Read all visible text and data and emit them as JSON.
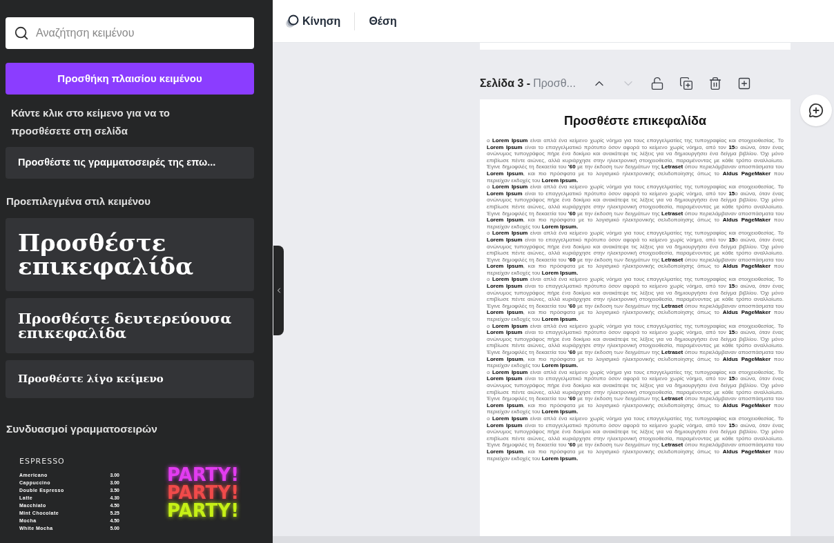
{
  "sidebar": {
    "search": {
      "placeholder": "Αναζήτηση κειμένου"
    },
    "add_button": "Προσθήκη πλαισίου κειμένου",
    "hint": "Κάντε κλικ στο κείμενο για να το προσθέσετε στη σελίδα",
    "brand_fonts_button": "Προσθέστε τις γραμματοσειρές της επω...",
    "styles_heading": "Προεπιλεγμένα στιλ κειμένου",
    "styles": [
      {
        "kind": "heading",
        "label": "Προσθέστε επικεφαλίδα"
      },
      {
        "kind": "subheading",
        "label": "Προσθέστε δευτερεύουσα επικεφαλίδα"
      },
      {
        "kind": "body",
        "label": "Προσθέστε λίγο κείμενο"
      }
    ],
    "combos_heading": "Συνδυασμοί γραμματοσειρών",
    "combos": [
      {
        "kind": "menu",
        "title": "ESPRESSO",
        "items": [
          {
            "name": "Americano",
            "price": "3.00"
          },
          {
            "name": "Cappuccino",
            "price": "3.00"
          },
          {
            "name": "Double Espresso",
            "price": "3.50"
          },
          {
            "name": "Latte",
            "price": "4.30"
          },
          {
            "name": "Macchiato",
            "price": "4.50"
          },
          {
            "name": "Mint Chocolate",
            "price": "5.25"
          },
          {
            "name": "Mocha",
            "price": "4.50"
          },
          {
            "name": "White Mocha",
            "price": "5.00"
          }
        ]
      },
      {
        "kind": "neon",
        "lines": [
          {
            "text": "PARTY!",
            "color": "#e23cf0"
          },
          {
            "text": "PARTY!",
            "color": "#f04a4a"
          },
          {
            "text": "PARTY!",
            "color": "#c6f016"
          }
        ]
      }
    ]
  },
  "toolbar": {
    "items": [
      {
        "kind": "animate",
        "label": "Κίνηση"
      },
      {
        "kind": "position",
        "label": "Θέση"
      }
    ]
  },
  "page_header": {
    "title": "Σελίδα 3 -",
    "name": "Προσθ...",
    "actions": [
      {
        "kind": "up",
        "disabled": false
      },
      {
        "kind": "down",
        "disabled": true
      },
      {
        "kind": "lock",
        "disabled": false
      },
      {
        "kind": "duplicate",
        "disabled": false
      },
      {
        "kind": "delete",
        "disabled": false
      },
      {
        "kind": "add",
        "disabled": false
      }
    ]
  },
  "page": {
    "heading": "Προσθέστε επικεφαλίδα",
    "paragraphs": [
      "ο **Lorem Ipsum** είναι απλά ένα κείμενο χωρίς νόημα για τους επαγγελματίες της τυπογραφίας και στοιχειοθεσίας. Το **Lorem Ipsum** είναι το επαγγελματικό πρότυπο όσον αφορά το κείμενο χωρίς νόημα, από τον **15**ο αιώνα, όταν ένας ανώνυμος τυπογράφος πήρε ένα δοκίμιο και ανακάτεψε τις λέξεις για να δημιουργήσει ένα δείγμα βιβλίου. Όχι μόνο επιβίωσε πέντε αιώνες, αλλά κυριάρχησε στην ηλεκτρονική στοιχειοθεσία, παραμένοντας με κάθε τρόπο αναλλοίωτο. Έγινε δημοφιλές τη δεκαετία του **'60** με την έκδοση των δειγμάτων της **Letraset** όπου περιελάμβαναν αποσπάσματα του **Lorem Ipsum**, και πιο πρόσφατα με το λογισμικό ηλεκτρονικής σελιδοποίησης όπως το **Aldus PageMaker** που περιείχαν εκδοχές του **Lorem Ipsum.**",
      "ο **Lorem Ipsum** είναι απλά ένα κείμενο χωρίς νόημα για τους επαγγελματίες της τυπογραφίας και στοιχειοθεσίας. Το **Lorem Ipsum** είναι το επαγγελματικό πρότυπο όσον αφορά το κείμενο χωρίς νόημα, από τον **15**ο αιώνα, όταν ένας ανώνυμος τυπογράφος πήρε ένα δοκίμιο και ανακάτεψε τις λέξεις για να δημιουργήσει ένα δείγμα βιβλίου. Όχι μόνο επιβίωσε πέντε αιώνες, αλλά κυριάρχησε στην ηλεκτρονική στοιχειοθεσία, παραμένοντας με κάθε τρόπο αναλλοίωτο. Έγινε δημοφιλές τη δεκαετία του **'60** με την έκδοση των δειγμάτων της **Letraset** όπου περιελάμβαναν αποσπάσματα του **Lorem Ipsum**, και πιο πρόσφατα με το λογισμικό ηλεκτρονικής σελιδοποίησης όπως το **Aldus PageMaker** που περιείχαν εκδοχές του **Lorem Ipsum.**",
      "ο **Lorem Ipsum** είναι απλά ένα κείμενο χωρίς νόημα για τους επαγγελματίες της τυπογραφίας και στοιχειοθεσίας. Το **Lorem Ipsum** είναι το επαγγελματικό πρότυπο όσον αφορά το κείμενο χωρίς νόημα, από τον **15**ο αιώνα, όταν ένας ανώνυμος τυπογράφος πήρε ένα δοκίμιο και ανακάτεψε τις λέξεις για να δημιουργήσει ένα δείγμα βιβλίου. Όχι μόνο επιβίωσε πέντε αιώνες, αλλά κυριάρχησε στην ηλεκτρονική στοιχειοθεσία, παραμένοντας με κάθε τρόπο αναλλοίωτο. Έγινε δημοφιλές τη δεκαετία του **'60** με την έκδοση των δειγμάτων της **Letraset** όπου περιελάμβαναν αποσπάσματα του **Lorem Ipsum**, και πιο πρόσφατα με το λογισμικό ηλεκτρονικής σελιδοποίησης όπως το **Aldus PageMaker** που περιείχαν εκδοχές του **Lorem Ipsum.**",
      "ο **Lorem Ipsum** είναι απλά ένα κείμενο χωρίς νόημα για τους επαγγελματίες της τυπογραφίας και στοιχειοθεσίας. Το **Lorem Ipsum** είναι το επαγγελματικό πρότυπο όσον αφορά το κείμενο χωρίς νόημα, από τον **15**ο αιώνα, όταν ένας ανώνυμος τυπογράφος πήρε ένα δοκίμιο και ανακάτεψε τις λέξεις για να δημιουργήσει ένα δείγμα βιβλίου. Όχι μόνο επιβίωσε πέντε αιώνες, αλλά κυριάρχησε στην ηλεκτρονική στοιχειοθεσία, παραμένοντας με κάθε τρόπο αναλλοίωτο. Έγινε δημοφιλές τη δεκαετία του **'60** με την έκδοση των δειγμάτων της **Letraset** όπου περιελάμβαναν αποσπάσματα του **Lorem Ipsum**, και πιο πρόσφατα με το λογισμικό ηλεκτρονικής σελιδοποίησης όπως το **Aldus PageMaker** που περιείχαν εκδοχές του **Lorem Ipsum.**",
      "ο **Lorem Ipsum** είναι απλά ένα κείμενο χωρίς νόημα για τους επαγγελματίες της τυπογραφίας και στοιχειοθεσίας. Το **Lorem Ipsum** είναι το επαγγελματικό πρότυπο όσον αφορά το κείμενο χωρίς νόημα, από τον **15**ο αιώνα, όταν ένας ανώνυμος τυπογράφος πήρε ένα δοκίμιο και ανακάτεψε τις λέξεις για να δημιουργήσει ένα δείγμα βιβλίου. Όχι μόνο επιβίωσε πέντε αιώνες, αλλά κυριάρχησε στην ηλεκτρονική στοιχειοθεσία, παραμένοντας με κάθε τρόπο αναλλοίωτο. Έγινε δημοφιλές τη δεκαετία του **'60** με την έκδοση των δειγμάτων της **Letraset** όπου περιελάμβαναν αποσπάσματα του **Lorem Ipsum**, και πιο πρόσφατα με το λογισμικό ηλεκτρονικής σελιδοποίησης όπως το **Aldus PageMaker** που περιείχαν εκδοχές του **Lorem Ipsum.**",
      "ο **Lorem Ipsum** είναι απλά ένα κείμενο χωρίς νόημα για τους επαγγελματίες της τυπογραφίας και στοιχειοθεσίας. Το **Lorem Ipsum** είναι το επαγγελματικό πρότυπο όσον αφορά το κείμενο χωρίς νόημα, από τον **15**ο αιώνα, όταν ένας ανώνυμος τυπογράφος πήρε ένα δοκίμιο και ανακάτεψε τις λέξεις για να δημιουργήσει ένα δείγμα βιβλίου. Όχι μόνο επιβίωσε πέντε αιώνες, αλλά κυριάρχησε στην ηλεκτρονική στοιχειοθεσία, παραμένοντας με κάθε τρόπο αναλλοίωτο. Έγινε δημοφιλές τη δεκαετία του **'60** με την έκδοση των δειγμάτων της **Letraset** όπου περιελάμβαναν αποσπάσματα του **Lorem Ipsum**, και πιο πρόσφατα με το λογισμικό ηλεκτρονικής σελιδοποίησης όπως το **Aldus PageMaker** που περιείχαν εκδοχές του **Lorem Ipsum.**",
      "ο **Lorem Ipsum** είναι απλά ένα κείμενο χωρίς νόημα για τους επαγγελματίες της τυπογραφίας και στοιχειοθεσίας. Το **Lorem Ipsum** είναι το επαγγελματικό πρότυπο όσον αφορά το κείμενο χωρίς νόημα, από τον **15**ο αιώνα, όταν ένας ανώνυμος τυπογράφος πήρε ένα δοκίμιο και ανακάτεψε τις λέξεις για να δημιουργήσει ένα δείγμα βιβλίου. Όχι μόνο επιβίωσε πέντε αιώνες, αλλά κυριάρχησε στην ηλεκτρονική στοιχειοθεσία, παραμένοντας με κάθε τρόπο αναλλοίωτο. Έγινε δημοφιλές τη δεκαετία του **'60** με την έκδοση των δειγμάτων της **Letraset** όπου περιελάμβαναν αποσπάσματα του **Lorem Ipsum**, και πιο πρόσφατα με το λογισμικό ηλεκτρονικής σελιδοποίησης όπως το **Aldus PageMaker** που περιείχαν εκδοχές του **Lorem Ipsum.**"
    ]
  }
}
